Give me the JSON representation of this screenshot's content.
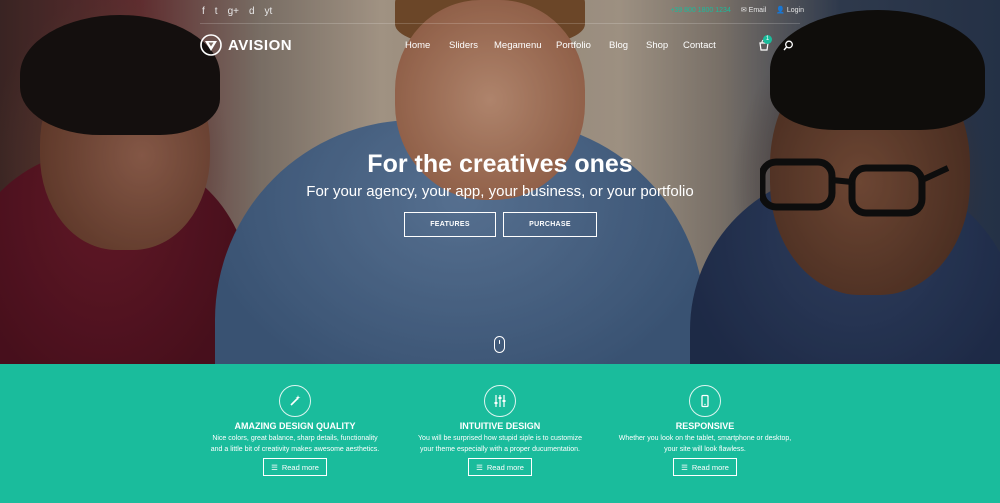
{
  "topbar": {
    "social": [
      "f",
      "t",
      "g+",
      "d",
      "yt"
    ],
    "phone": "+39 800 1800 1234",
    "email": "Email",
    "login": "Login"
  },
  "brand": {
    "name": "AVISION"
  },
  "nav": {
    "items": [
      "Home",
      "Sliders",
      "Megamenu",
      "Portfolio",
      "Blog",
      "Shop",
      "Contact"
    ],
    "cart_count": "1"
  },
  "hero": {
    "title": "For the creatives ones",
    "subtitle": "For your agency, your app, your business, or your portfolio",
    "btn_features": "FEATURES",
    "btn_purchase": "PURCHASE"
  },
  "features": [
    {
      "icon": "magic-wand-icon",
      "title": "AMAZING DESIGN QUALITY",
      "desc_line1": "Nice colors, great balance, sharp details, functionality",
      "desc_line2": "and a little bit of creativity makes awesome aesthetics.",
      "button": "Read more"
    },
    {
      "icon": "sliders-icon",
      "title": "INTUITIVE DESIGN",
      "desc_line1": "You will be surprised how stupid siple is to customize",
      "desc_line2": "your theme especially with a proper ducumentation.",
      "button": "Read more"
    },
    {
      "icon": "mobile-icon",
      "title": "RESPONSIVE",
      "desc_line1": "Whether you look on the tablet, smartphone or desktop,",
      "desc_line2": "your site will look flawless.",
      "button": "Read more"
    }
  ],
  "colors": {
    "accent": "#1abc9c"
  }
}
